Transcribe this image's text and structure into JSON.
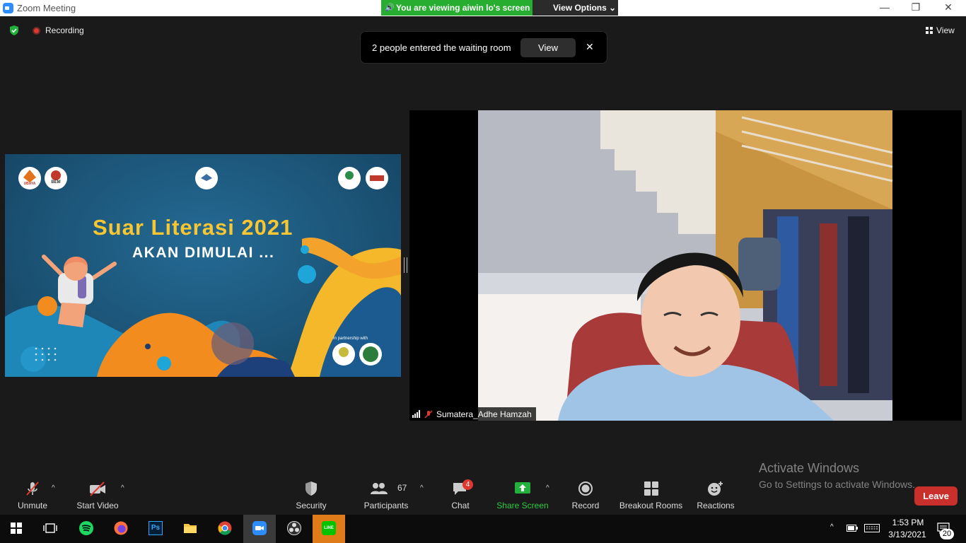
{
  "window": {
    "title": "Zoom Meeting",
    "minimize": "—",
    "maximize": "❐",
    "close": "✕"
  },
  "banner": {
    "viewing": "You are viewing aiwin lo's screen",
    "view_options": "View Options ⌄",
    "color": "#27ae30"
  },
  "top": {
    "recording": "Recording",
    "view": "View"
  },
  "toast": {
    "message": "2 people entered the waiting room",
    "button": "View",
    "close": "✕"
  },
  "shared_screen": {
    "title": "Suar Literasi 2021",
    "subtitle": "AKAN DIMULAI ...",
    "partnership": "In partnership with",
    "logos": [
      "UBAYA",
      "BEM"
    ]
  },
  "participant": {
    "name": "Sumatera_Adhe Hamzah"
  },
  "watermark": {
    "line1": "Activate Windows",
    "line2": "Go to Settings to activate Windows."
  },
  "toolbar": {
    "unmute": "Unmute",
    "start_video": "Start Video",
    "security": "Security",
    "participants": "Participants",
    "participants_count": "67",
    "chat": "Chat",
    "chat_badge": "4",
    "share_screen": "Share Screen",
    "record": "Record",
    "breakout_rooms": "Breakout Rooms",
    "reactions": "Reactions",
    "leave": "Leave",
    "caret": "^"
  },
  "taskbar": {
    "time": "1:53 PM",
    "date": "3/13/2021",
    "notifications": "20",
    "apps": [
      "start",
      "task-view",
      "spotify",
      "firefox",
      "photoshop",
      "file-explorer",
      "chrome",
      "zoom",
      "obs",
      "line"
    ],
    "photoshop_label": "Ps",
    "line_label": "LINE"
  }
}
